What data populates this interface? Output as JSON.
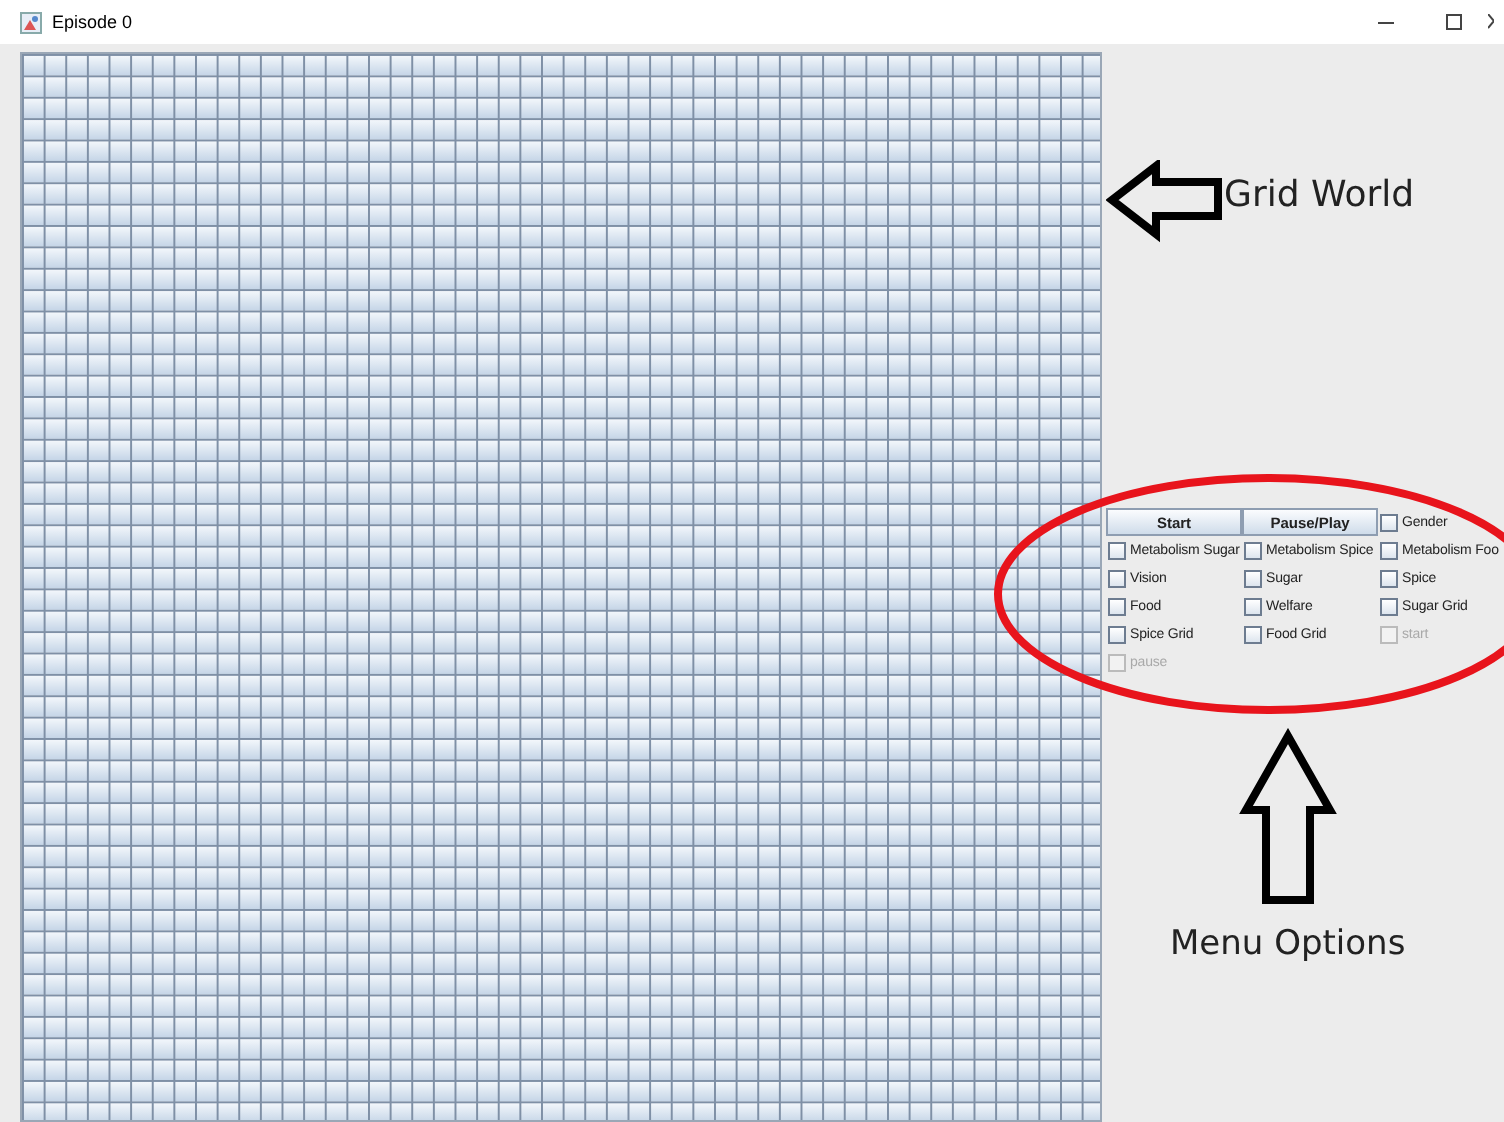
{
  "window": {
    "title": "Episode 0"
  },
  "controls": [
    {
      "kind": "button",
      "label": "Start"
    },
    {
      "kind": "button",
      "label": "Pause/Play"
    },
    {
      "kind": "checkbox",
      "label": "Gender",
      "checked": false,
      "disabled": false
    },
    {
      "kind": "checkbox",
      "label": "Metabolism Sugar",
      "checked": false,
      "disabled": false
    },
    {
      "kind": "checkbox",
      "label": "Metabolism Spice",
      "checked": false,
      "disabled": false
    },
    {
      "kind": "checkbox",
      "label": "Metabolism Foo",
      "checked": false,
      "disabled": false
    },
    {
      "kind": "checkbox",
      "label": "Vision",
      "checked": false,
      "disabled": false
    },
    {
      "kind": "checkbox",
      "label": "Sugar",
      "checked": false,
      "disabled": false
    },
    {
      "kind": "checkbox",
      "label": "Spice",
      "checked": false,
      "disabled": false
    },
    {
      "kind": "checkbox",
      "label": "Food",
      "checked": false,
      "disabled": false
    },
    {
      "kind": "checkbox",
      "label": "Welfare",
      "checked": false,
      "disabled": false
    },
    {
      "kind": "checkbox",
      "label": "Sugar Grid",
      "checked": false,
      "disabled": false
    },
    {
      "kind": "checkbox",
      "label": "Spice Grid",
      "checked": false,
      "disabled": false
    },
    {
      "kind": "checkbox",
      "label": "Food Grid",
      "checked": false,
      "disabled": false
    },
    {
      "kind": "checkbox",
      "label": "start",
      "checked": false,
      "disabled": true
    },
    {
      "kind": "checkbox",
      "label": "pause",
      "checked": false,
      "disabled": true
    }
  ],
  "annotations": {
    "grid_label": "Grid World",
    "menu_label": "Menu Options"
  }
}
